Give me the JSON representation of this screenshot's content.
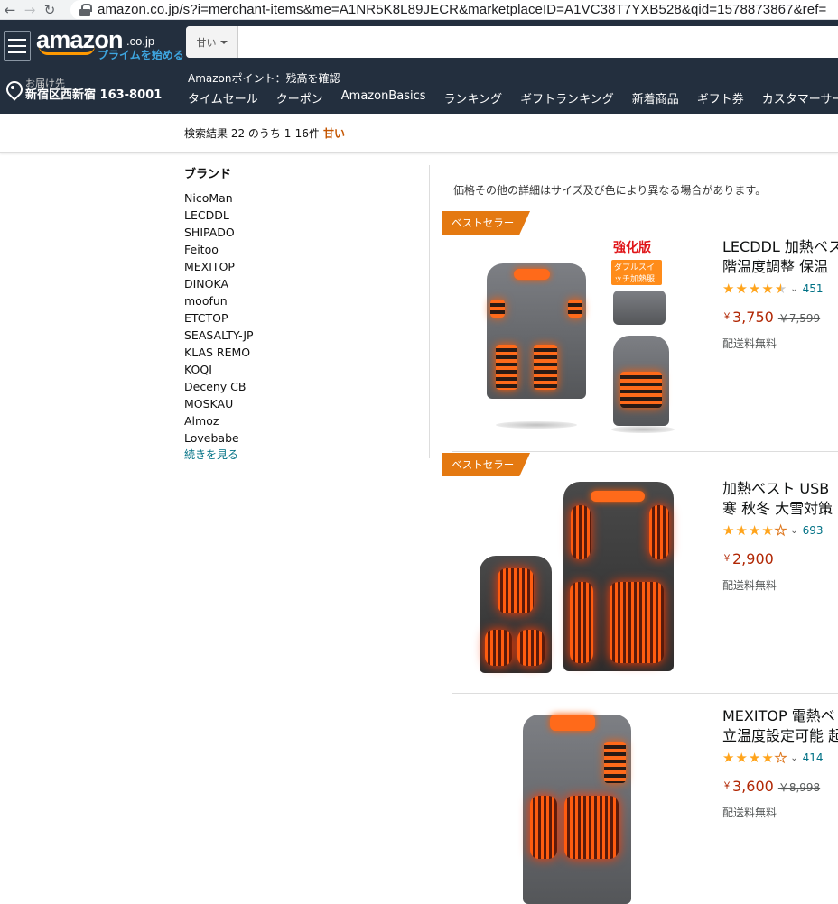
{
  "browser": {
    "url": "amazon.co.jp/s?i=merchant-items&me=A1NR5K8L89JECR&marketplaceID=A1VC38T7YXB528&qid=1578873867&ref="
  },
  "header": {
    "logo_text": "amazon",
    "logo_tld": ".co.jp",
    "prime_link": "プライムを始める",
    "search_dept": "甘い",
    "search_value": "",
    "deliver_label": "お届け先",
    "deliver_address": "新宿区西新宿 163-8001",
    "points_text": "Amazonポイント：残高を確認",
    "nav": [
      "タイムセール",
      "クーポン",
      "AmazonBasics",
      "ランキング",
      "ギフトランキング",
      "新着商品",
      "ギフト券",
      "カスタマーサービス"
    ]
  },
  "results": {
    "summary": "検索結果 22 のうち 1-16件",
    "query": "甘い",
    "notice": "価格その他の詳細はサイズ及び色により異なる場合があります。"
  },
  "sidebar": {
    "title": "ブランド",
    "brands": [
      "NicoMan",
      "LECDDL",
      "SHIPADO",
      "Feitoo",
      "MEXITOP",
      "DINOKA",
      "moofun",
      "ETCTOP",
      "SEASALTY-JP",
      "KLAS REMO",
      "KOQI",
      "Deceny CB",
      "MOSKAU",
      "Almoz",
      "Lovebabe"
    ],
    "see_more": "続きを見る"
  },
  "products": [
    {
      "badge": "ベストセラー",
      "title_line1": "LECDDL 加熱ベス",
      "title_line2": "階温度調整 保温",
      "stars": 4.5,
      "reviews": "451",
      "price": "3,750",
      "list_price": "￥7,599",
      "shipping": "配送料無料",
      "img_label_top": "強化版",
      "img_label_sub": "ダブルスイッチ加熱服"
    },
    {
      "badge": "ベストセラー",
      "title_line1": "加熱ベスト USB",
      "title_line2": "寒 秋冬 大雪対策",
      "stars": 4,
      "reviews": "693",
      "price": "2,900",
      "list_price": "",
      "shipping": "配送料無料"
    },
    {
      "badge": "",
      "title_line1": "MEXITOP 電熱ベ",
      "title_line2": "立温度設定可能 起",
      "stars": 4,
      "reviews": "414",
      "price": "3,600",
      "list_price": "￥8,998",
      "shipping": "配送料無料"
    }
  ],
  "currency_symbol": "￥",
  "colors": {
    "amazon_dark": "#232f3e",
    "badge_orange": "#e47911",
    "price_red": "#b12704",
    "link_teal": "#007185",
    "star": "#ffa41c"
  }
}
